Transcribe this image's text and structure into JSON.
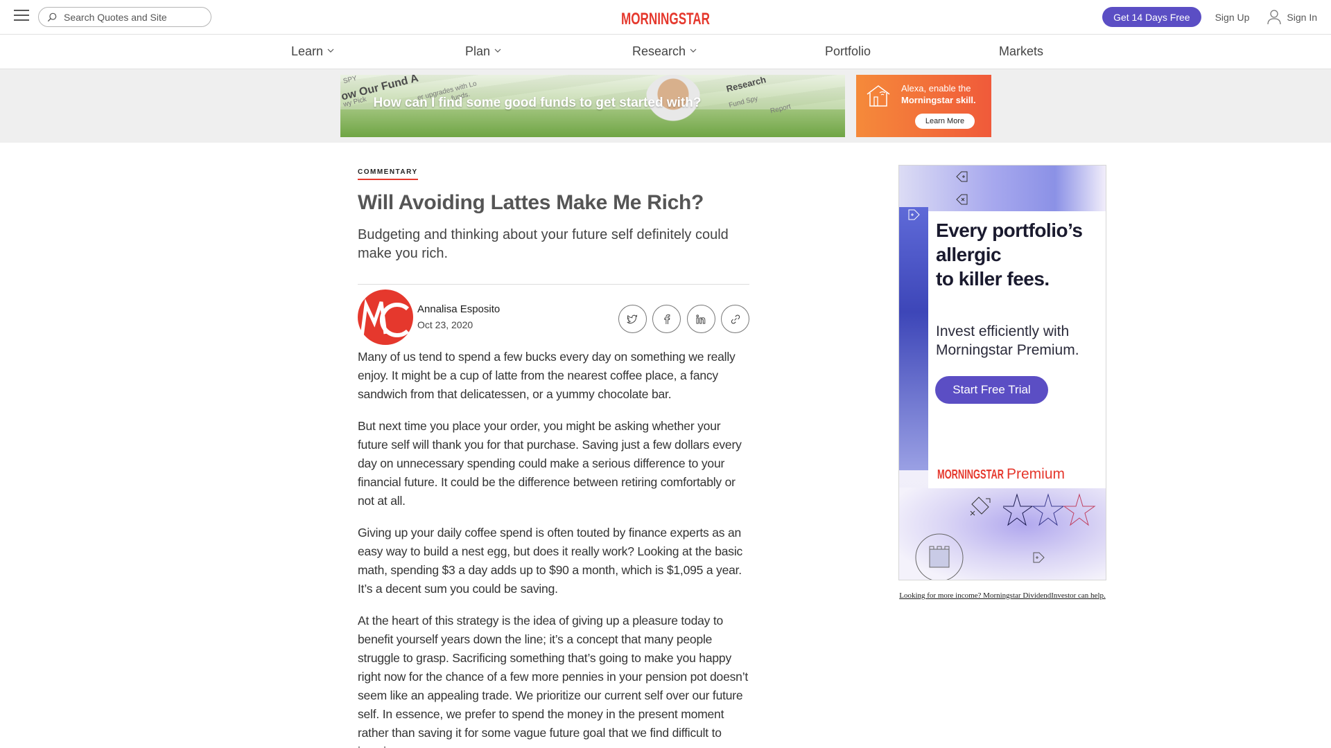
{
  "header": {
    "search_placeholder": "Search Quotes and Site",
    "logo_text": "MORNINGSTAR",
    "free_trial_label": "Get 14 Days Free",
    "signup_label": "Sign Up",
    "signin_label": "Sign In",
    "accent_color": "#5b4ec4",
    "brand_red": "#e5382d"
  },
  "nav": {
    "items": [
      {
        "label": "Learn",
        "has_dropdown": true
      },
      {
        "label": "Plan",
        "has_dropdown": true
      },
      {
        "label": "Research",
        "has_dropdown": true
      },
      {
        "label": "Portfolio",
        "has_dropdown": false
      },
      {
        "label": "Markets",
        "has_dropdown": false
      }
    ]
  },
  "banner_ads": {
    "fund_ad": {
      "headline": "How can I find some good funds to get started with?",
      "background_words": [
        "ow Our Fund A",
        "Research",
        "SPY",
        "wy Pick",
        "er upgrades with Lo",
        "funds.",
        "Fund Spy",
        "Report"
      ]
    },
    "alexa_ad": {
      "line1": "Alexa, enable the",
      "line2": "Morningstar skill.",
      "button": "Learn More"
    }
  },
  "article": {
    "kicker": "COMMENTARY",
    "title": "Will Avoiding Lattes Make Me Rich?",
    "subtitle": "Budgeting and thinking about your future self definitely could make you rich.",
    "author": "Annalisa Esposito",
    "date": "Oct 23, 2020",
    "share_icons": [
      "twitter-icon",
      "facebook-icon",
      "linkedin-icon",
      "link-icon"
    ],
    "paragraphs": [
      "Many of us tend to spend a few bucks every day on something we really enjoy. It might be a cup of latte from the nearest coffee place, a fancy sandwich from that delicatessen, or a yummy chocolate bar.",
      "But next time you place your order, you might be asking whether your future self will thank you for that purchase. Saving just a few dollars every day on unnecessary spending could make a serious difference to your financial future. It could be the difference between retiring comfortably or not at all.",
      "Giving up your daily coffee spend is often touted by finance experts as an easy way to build a nest egg, but does it really work? Looking at the basic math, spending $3 a day adds up to $90 a month, which is $1,095 a year. It’s a decent sum you could be saving.",
      "At the heart of this strategy is the idea of giving up a pleasure today to benefit yourself years down the line; it’s a concept that many people struggle to grasp. Sacrificing something that’s going to make you happy right now for the chance of a few more pennies in your pension pot doesn’t seem like an appealing trade. We prioritize our current self over our future self. In essence, we prefer to spend the money in the present moment rather than saving it for some vague future goal that we find difficult to imagine."
    ]
  },
  "side_ad": {
    "headline": "Every portfolio’s allergic to killer fees.",
    "headline_lines": [
      "Every portfolio’s",
      "allergic",
      "to killer fees."
    ],
    "subhead_lines": [
      "Invest efficiently with",
      "Morningstar Premium."
    ],
    "cta": "Start Free Trial",
    "brand_main": "MORNINGSTAR",
    "brand_suffix": "Premium",
    "caption": "Looking for more income? Morningstar DividendInvestor can help."
  }
}
